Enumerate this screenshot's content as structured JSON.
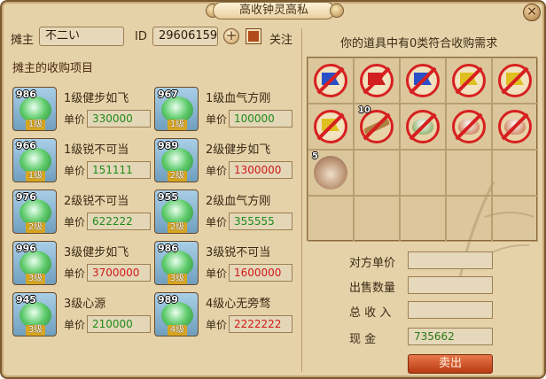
{
  "window": {
    "title": "高收钟灵高私",
    "close_glyph": "×"
  },
  "header": {
    "stall_owner_label": "摊主",
    "stall_owner_value": "不二い",
    "id_label": "ID",
    "id_value": "29606159",
    "add_glyph": "+",
    "follow_label": "关注"
  },
  "left": {
    "section_title": "摊主的收购项目",
    "price_label": "单价",
    "items": [
      {
        "count": "986",
        "level": "1级",
        "name": "1级健步如飞",
        "price": "330000",
        "price_color": "#1f8a1a"
      },
      {
        "count": "967",
        "level": "1级",
        "name": "1级血气方刚",
        "price": "100000",
        "price_color": "#1f8a1a"
      },
      {
        "count": "966",
        "level": "1级",
        "name": "1级锐不可当",
        "price": "151111",
        "price_color": "#1f8a1a"
      },
      {
        "count": "989",
        "level": "2级",
        "name": "2级健步如飞",
        "price": "1300000",
        "price_color": "#d01a1a"
      },
      {
        "count": "976",
        "level": "2级",
        "name": "2级锐不可当",
        "price": "622222",
        "price_color": "#1f8a1a"
      },
      {
        "count": "955",
        "level": "2级",
        "name": "2级血气方刚",
        "price": "355555",
        "price_color": "#1f8a1a"
      },
      {
        "count": "996",
        "level": "3级",
        "name": "3级健步如飞",
        "price": "3700000",
        "price_color": "#d01a1a"
      },
      {
        "count": "986",
        "level": "3级",
        "name": "3级锐不可当",
        "price": "1600000",
        "price_color": "#d01a1a"
      },
      {
        "count": "945",
        "level": "3级",
        "name": "3级心源",
        "price": "210000",
        "price_color": "#1f8a1a"
      },
      {
        "count": "989",
        "level": "4级",
        "name": "4级心无旁骛",
        "price": "2222222",
        "price_color": "#d01a1a"
      }
    ]
  },
  "right": {
    "inventory_title": "你的道具中有0类符合收购需求",
    "inventory": [
      {
        "kind": "flag",
        "color": "#2a50c8",
        "count": ""
      },
      {
        "kind": "flag",
        "color": "#d02020",
        "count": ""
      },
      {
        "kind": "flag",
        "color": "#2a50c8",
        "count": ""
      },
      {
        "kind": "flag",
        "color": "#e0c020",
        "count": ""
      },
      {
        "kind": "flag",
        "color": "#e0c020",
        "count": ""
      },
      {
        "kind": "flag",
        "color": "#e0c020",
        "count": ""
      },
      {
        "kind": "scroll",
        "color": "#b08040",
        "count": "10"
      },
      {
        "kind": "bowl",
        "color": "#6f9a40",
        "count": ""
      },
      {
        "kind": "bowl",
        "color": "#c06030",
        "count": ""
      },
      {
        "kind": "bowl",
        "color": "#c06030",
        "count": ""
      },
      {
        "kind": "shell",
        "color": "#b89070",
        "count": "5"
      }
    ],
    "fields": {
      "buyer_price_label": "对方单价",
      "sell_qty_label": "出售数量",
      "total_label": "总 收 入",
      "cash_label": "现   金",
      "buyer_price_value": "",
      "sell_qty_value": "",
      "total_value": "",
      "cash_value": "735662"
    },
    "sell_button": "卖出"
  }
}
